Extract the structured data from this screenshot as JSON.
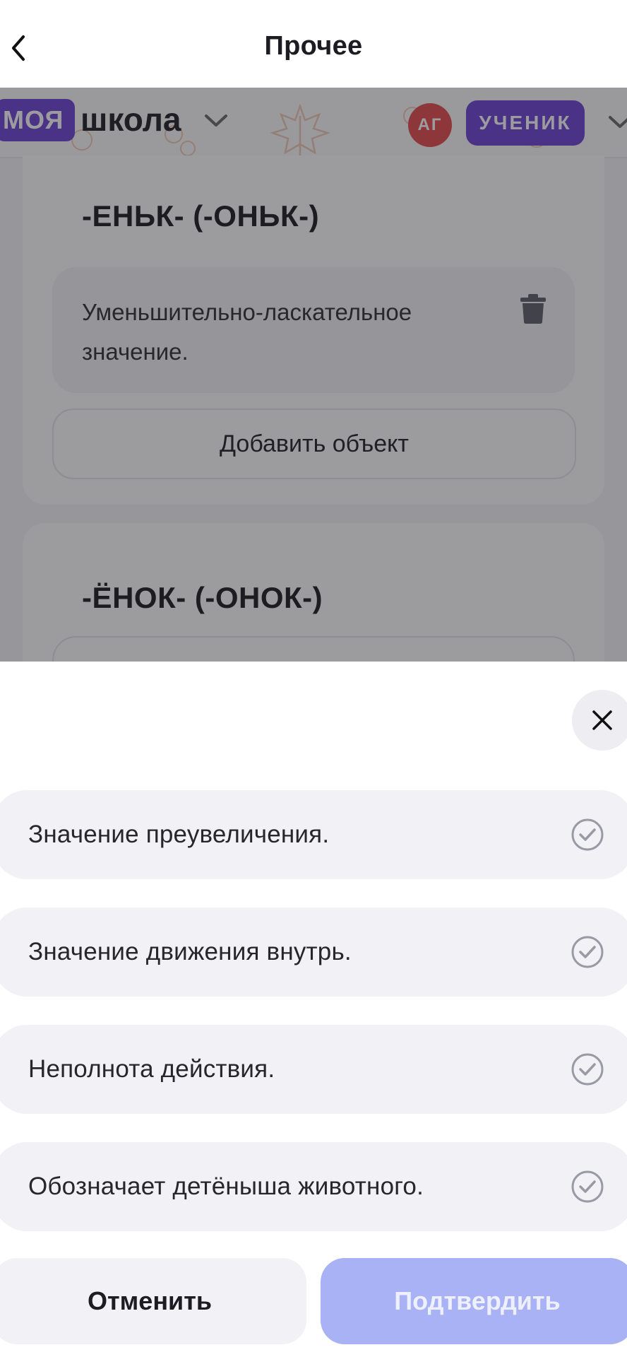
{
  "header": {
    "title": "Прочее"
  },
  "school_bar": {
    "tag": "МОЯ",
    "school_name": "школа",
    "avatar_initials": "АГ",
    "role": "УЧЕНИК"
  },
  "cards": [
    {
      "title": "-ЕНЬК- (-ОНЬК-)",
      "item_text": "Уменьшительно-ласкательное значение.",
      "add_label": "Добавить объект"
    },
    {
      "title": "-ЁНОК- (-ОНОК-)"
    }
  ],
  "sheet": {
    "options": [
      {
        "label": "Значение преувеличения."
      },
      {
        "label": "Значение движения внутрь."
      },
      {
        "label": "Неполнота действия."
      },
      {
        "label": "Обозначает детёныша животного."
      }
    ],
    "cancel_label": "Отменить",
    "confirm_label": "Подтвердить"
  },
  "colors": {
    "accent_purple": "#6b3fd6",
    "avatar_red": "#e6484b",
    "confirm_disabled": "#a8b2f5"
  },
  "icons": {
    "back": "chevron-left-icon",
    "close": "close-icon",
    "trash": "trash-icon",
    "check": "check-circle-icon",
    "dropdown": "chevron-down-icon"
  }
}
